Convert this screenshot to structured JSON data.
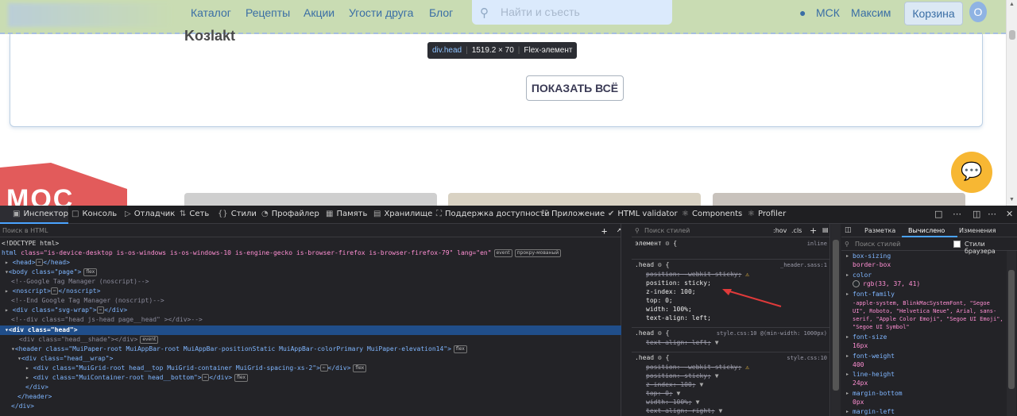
{
  "page": {
    "nav": [
      "Каталог",
      "Рецепты",
      "Акции",
      "Угости друга",
      "Блог"
    ],
    "search_placeholder": "Найти и съесть",
    "location": "МСК",
    "user_name": "Максим",
    "cart_label": "Корзина",
    "avatar_letter": "О",
    "card_title": "Koзlakt",
    "show_all_button": "ПОКАЗАТЬ ВСЁ",
    "ribbon_text": "МОС",
    "colors": {
      "header_bg": "#c9dcb3",
      "fab": "#f7b733",
      "accent": "#3a6ea5"
    }
  },
  "tooltip": {
    "selector": "div.head",
    "size": "1519.2 × 70",
    "kind": "Flex-элемент"
  },
  "devtools": {
    "tabs": [
      "Инспектор",
      "Консоль",
      "Отладчик",
      "Сеть",
      "Стили",
      "Профайлер",
      "Память",
      "Хранилище",
      "Поддержка доступности",
      "Приложение",
      "HTML validator",
      "Components",
      "Profiler"
    ],
    "html_search_placeholder": "Поиск в HTML",
    "tree": {
      "doctype": "<!DOCTYPE html>",
      "html_attrs": "class=\"is-device-desktop is-os-windows is-os-windows-10 is-engine-gecko is-browser-firefox is-browser-firefox-79\" lang=\"en\"",
      "badge_event": "event",
      "badge_scroll": "прокру-мованый",
      "badge_flex": "flex",
      "comment_gtm_open": "<!--Google Tag Manager (noscript)-->",
      "noscript": "<noscript>",
      "noscript_close": "</noscript>",
      "comment_gtm_close": "<!--End Google Tag Manager (noscript)-->",
      "svg_wrap": "<div class=\"svg-wrap\">",
      "head_comment": "<!--div class=\"head js-head page__head\" ></div>-->",
      "selected": "<div class=\"head\">",
      "shade": "<div class=\"head__shade\"></div>",
      "header": "<header class=\"MuiPaper-root MuiAppBar-root MuiAppBar-positionStatic MuiAppBar-colorPrimary MuiPaper-elevation14\">",
      "head_wrap": "<div class=\"head__wrap\">",
      "grid_div": "<div class=\"MuiGrid-root head__top MuiGrid-container MuiGrid-spacing-xs-2\">",
      "container_div": "<div class=\"MuiContainer-root head__bottom\">",
      "close_div": "</div>",
      "close_header": "</header>",
      "head": "<head>",
      "head_close": "</head>",
      "body": "<body class=\"page\">"
    },
    "rules": {
      "search_placeholder": "Поиск стилей",
      "hov": ":hov",
      "cls": ".cls",
      "element_label": "элемент",
      "inline": "inline",
      "rule1_selector": ".head",
      "rule1_source": "_header.sass:1",
      "rule1_props": [
        "position: -webkit-sticky;",
        "position: sticky;",
        "z-index: 100;",
        "top: 0;",
        "width: 100%;",
        "text-align: left;"
      ],
      "rule2_selector": ".head",
      "rule2_source": "style.css:10 @(min-width: 1000px)",
      "rule2_props": [
        "text-align: left;"
      ],
      "rule3_selector": ".head",
      "rule3_source": "style.css:10",
      "rule3_props": [
        "position: -webkit-sticky;",
        "position: sticky;",
        "z-index: 100;",
        "top: 0;",
        "width: 100%;",
        "text-align: right;"
      ]
    },
    "computed": {
      "tabs": [
        "Разметка",
        "Вычислено",
        "Изменения"
      ],
      "search_placeholder": "Поиск стилей",
      "browser_styles": "Стили браузера",
      "props": [
        {
          "name": "box-sizing",
          "value": "border-box"
        },
        {
          "name": "color",
          "value": "rgb(33, 37, 41)"
        },
        {
          "name": "font-family",
          "value": "-apple-system, BlinkMacSystemFont, \"Segoe UI\", Roboto, \"Helvetica Neue\", Arial, sans-serif, \"Apple Color Emoji\", \"Segoe UI Emoji\", \"Segoe UI Symbol\""
        },
        {
          "name": "font-size",
          "value": "16px"
        },
        {
          "name": "font-weight",
          "value": "400"
        },
        {
          "name": "line-height",
          "value": "24px"
        },
        {
          "name": "margin-bottom",
          "value": "0px"
        },
        {
          "name": "margin-left",
          "value": ""
        }
      ]
    }
  }
}
